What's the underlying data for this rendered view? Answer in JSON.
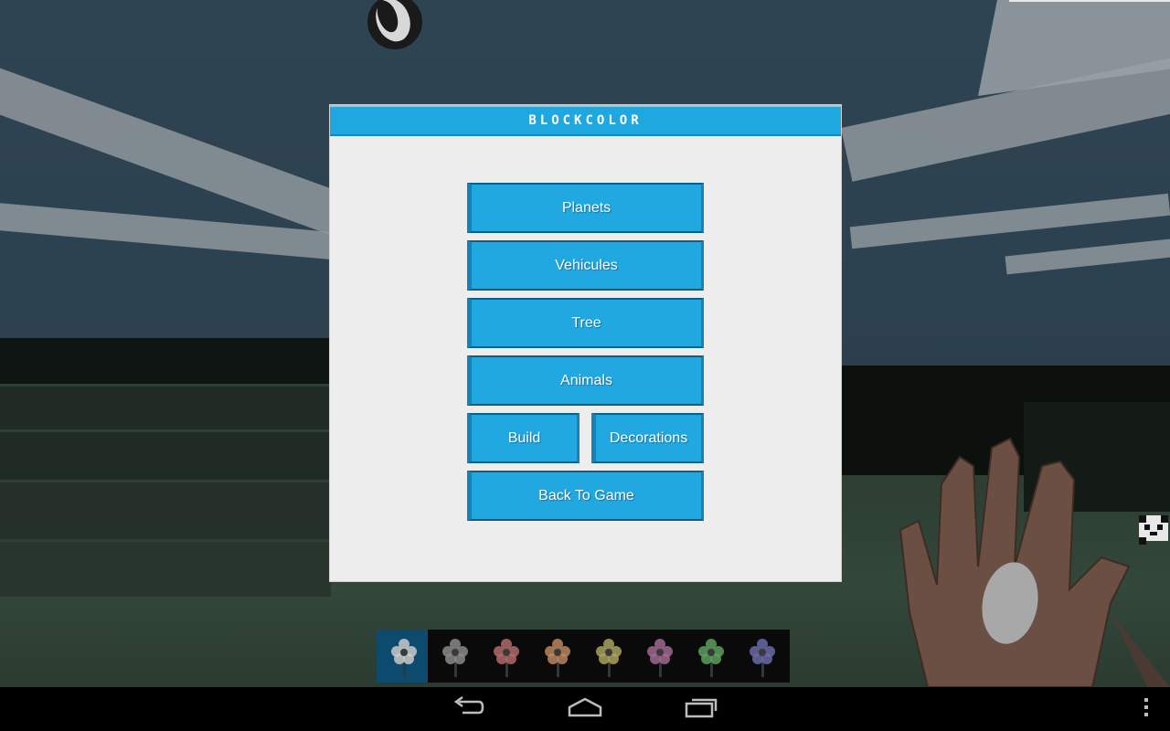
{
  "menu": {
    "title": "BLOCKCOLOR",
    "buttons": {
      "planets": "Planets",
      "vehicules": "Vehicules",
      "tree": "Tree",
      "animals": "Animals",
      "build": "Build",
      "decorations": "Decorations",
      "back_to_game": "Back To Game"
    }
  },
  "hotbar": {
    "selected_index": 0,
    "slots": [
      {
        "icon": "flower-icon",
        "color": "#c9c9c9"
      },
      {
        "icon": "flower-icon",
        "color": "#8a8a8a"
      },
      {
        "icon": "flower-icon",
        "color": "#b06a6a"
      },
      {
        "icon": "flower-icon",
        "color": "#b8865e"
      },
      {
        "icon": "flower-icon",
        "color": "#a8a25e"
      },
      {
        "icon": "flower-icon",
        "color": "#a0688f"
      },
      {
        "icon": "flower-icon",
        "color": "#5e9e5e"
      },
      {
        "icon": "flower-icon",
        "color": "#6a6aa8"
      }
    ]
  },
  "navbar": {
    "icons": [
      "back-icon",
      "home-icon",
      "recent-apps-icon",
      "overflow-menu-icon"
    ]
  },
  "colors": {
    "accent": "#22a8e1",
    "dialog_background": "#ededed",
    "navbar": "#000000"
  }
}
